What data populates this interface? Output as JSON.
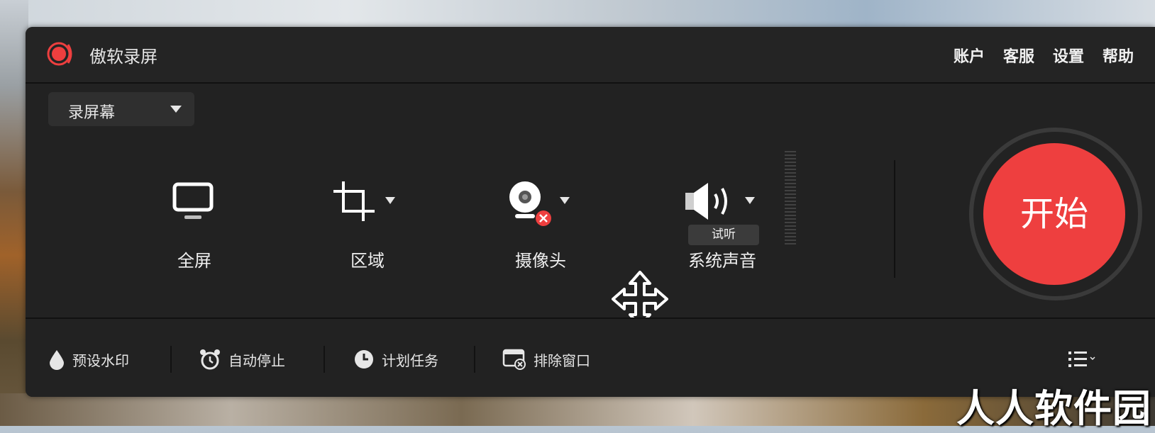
{
  "app": {
    "title": "傲软录屏"
  },
  "top_menu": {
    "account": "账户",
    "service": "客服",
    "settings": "设置",
    "help": "帮助"
  },
  "mode_select": {
    "selected": "录屏幕"
  },
  "sources": {
    "fullscreen": "全屏",
    "region": "区域",
    "camera": "摄像头",
    "system_audio": "系统声音",
    "test_listen": "试听"
  },
  "start_button": {
    "label": "开始"
  },
  "bottom_tools": {
    "watermark": "预设水印",
    "auto_stop": "自动停止",
    "schedule": "计划任务",
    "exclude_window": "排除窗口"
  },
  "overlay_watermark": "人人软件园",
  "colors": {
    "accent": "#ee3f3f",
    "panel": "#222222",
    "text": "#e6e6e6"
  },
  "icons": [
    "record-logo-icon",
    "monitor-icon",
    "crop-icon",
    "webcam-icon",
    "camera-disabled-icon",
    "speaker-icon",
    "move-cursor-icon",
    "droplet-icon",
    "alarm-clock-icon",
    "clock-icon",
    "window-exclude-icon",
    "list-menu-icon"
  ]
}
